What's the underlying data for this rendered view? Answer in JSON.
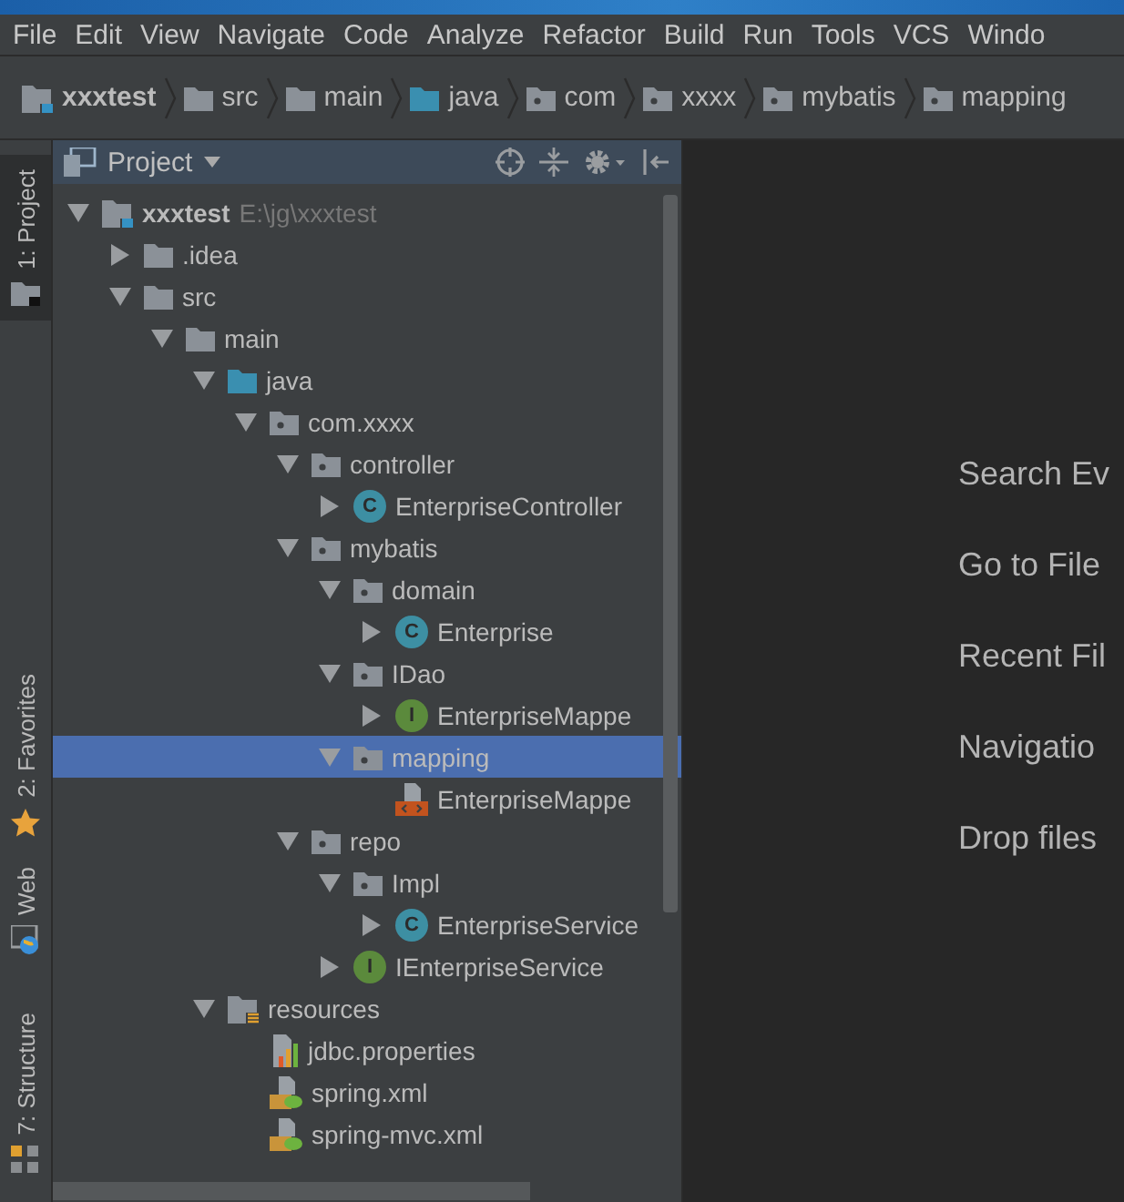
{
  "menu": [
    "File",
    "Edit",
    "View",
    "Navigate",
    "Code",
    "Analyze",
    "Refactor",
    "Build",
    "Run",
    "Tools",
    "VCS",
    "Windo"
  ],
  "breadcrumbs": [
    {
      "label": "xxxtest",
      "kind": "module"
    },
    {
      "label": "src",
      "kind": "folder"
    },
    {
      "label": "main",
      "kind": "folder"
    },
    {
      "label": "java",
      "kind": "source-root"
    },
    {
      "label": "com",
      "kind": "package"
    },
    {
      "label": "xxxx",
      "kind": "package"
    },
    {
      "label": "mybatis",
      "kind": "package"
    },
    {
      "label": "mapping",
      "kind": "package"
    }
  ],
  "tool_stripe": [
    {
      "label": "1: Project",
      "kind": "project",
      "selected": true
    },
    {
      "label": "2: Favorites",
      "kind": "favorites",
      "selected": false
    },
    {
      "label": "Web",
      "kind": "web",
      "selected": false
    },
    {
      "label": "7: Structure",
      "kind": "structure",
      "selected": false
    }
  ],
  "project_panel": {
    "title": "Project"
  },
  "tree": [
    {
      "label": "xxxtest",
      "kind": "module",
      "path": "E:\\jg\\xxxtest",
      "expanded": true,
      "selected": false,
      "children": [
        {
          "label": ".idea",
          "kind": "folder",
          "expanded": false,
          "selected": false
        },
        {
          "label": "src",
          "kind": "folder",
          "expanded": true,
          "selected": false,
          "children": [
            {
              "label": "main",
              "kind": "folder",
              "expanded": true,
              "selected": false,
              "children": [
                {
                  "label": "java",
                  "kind": "source-root",
                  "expanded": true,
                  "selected": false,
                  "children": [
                    {
                      "label": "com.xxxx",
                      "kind": "package",
                      "expanded": true,
                      "selected": false,
                      "children": [
                        {
                          "label": "controller",
                          "kind": "package",
                          "expanded": true,
                          "selected": false,
                          "children": [
                            {
                              "label": "EnterpriseController",
                              "kind": "class",
                              "icon_letter": "C",
                              "expanded": false,
                              "selected": false
                            }
                          ]
                        },
                        {
                          "label": "mybatis",
                          "kind": "package",
                          "expanded": true,
                          "selected": false,
                          "children": [
                            {
                              "label": "domain",
                              "kind": "package",
                              "expanded": true,
                              "selected": false,
                              "children": [
                                {
                                  "label": "Enterprise",
                                  "kind": "class",
                                  "icon_letter": "C",
                                  "expanded": false,
                                  "selected": false
                                }
                              ]
                            },
                            {
                              "label": "IDao",
                              "kind": "package",
                              "expanded": true,
                              "selected": false,
                              "children": [
                                {
                                  "label": "EnterpriseMappe",
                                  "kind": "interface",
                                  "icon_letter": "I",
                                  "expanded": false,
                                  "selected": false
                                }
                              ]
                            },
                            {
                              "label": "mapping",
                              "kind": "package",
                              "expanded": true,
                              "selected": true,
                              "children": [
                                {
                                  "label": "EnterpriseMappe",
                                  "kind": "xml",
                                  "selected": false
                                }
                              ]
                            }
                          ]
                        },
                        {
                          "label": "repo",
                          "kind": "package",
                          "expanded": true,
                          "selected": false,
                          "children": [
                            {
                              "label": "Impl",
                              "kind": "package",
                              "expanded": true,
                              "selected": false,
                              "children": [
                                {
                                  "label": "EnterpriseService",
                                  "kind": "class",
                                  "icon_letter": "C",
                                  "expanded": false,
                                  "selected": false
                                }
                              ]
                            },
                            {
                              "label": "IEnterpriseService",
                              "kind": "interface",
                              "icon_letter": "I",
                              "expanded": false,
                              "selected": false
                            }
                          ]
                        }
                      ]
                    }
                  ]
                },
                {
                  "label": "resources",
                  "kind": "resources",
                  "expanded": true,
                  "selected": false,
                  "children": [
                    {
                      "label": "jdbc.properties",
                      "kind": "properties",
                      "selected": false
                    },
                    {
                      "label": "spring.xml",
                      "kind": "spring-xml",
                      "selected": false
                    },
                    {
                      "label": "spring-mvc.xml",
                      "kind": "spring-xml",
                      "selected": false
                    }
                  ]
                }
              ]
            }
          ]
        }
      ]
    }
  ],
  "editor": {
    "hints": [
      "Search Ev",
      "Go to File",
      "Recent Fil",
      "Navigatio",
      "Drop files"
    ]
  }
}
